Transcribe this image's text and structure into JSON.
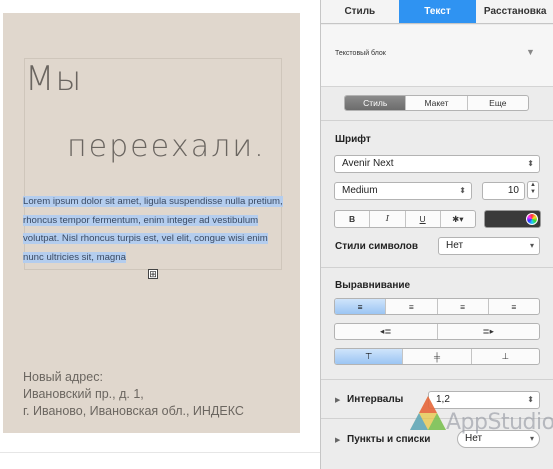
{
  "page": {
    "title_line1": "Мы",
    "title_line2": "переехали.",
    "body_text": "Lorem ipsum dolor sit amet, ligula suspendisse nulla pretium, rhoncus tempor fermentum, enim integer ad vestibulum volutpat. Nisl rhoncus turpis est, vel elit, congue wisi enim nunc ultricies sit, magna",
    "resize_handle": "⊞",
    "address": [
      "Новый адрес:",
      "Ивановский пр., д. 1,",
      "г. Иваново, Ивановская обл., ИНДЕКС"
    ]
  },
  "panel": {
    "tabs": [
      "Стиль",
      "Текст",
      "Расстановка"
    ],
    "active_tab": "Текст",
    "paragraph_style": "Текстовый блок",
    "subtabs": [
      "Стиль",
      "Макет",
      "Еще"
    ],
    "font_section": "Шрифт",
    "font_family": "Avenir Next",
    "font_weight": "Medium",
    "font_size": "10",
    "bold": "B",
    "italic": "I",
    "underline": "U",
    "gear": "✱▾",
    "char_styles_label": "Стили символов",
    "char_styles_value": "Нет",
    "alignment_label": "Выравнивание",
    "align_left": "≡",
    "align_center": "≡",
    "align_right": "≡",
    "align_justify": "≡",
    "indent_decrease": "◂≣",
    "indent_increase": "≣▸",
    "valign_top": "⊤",
    "valign_middle": "╪",
    "valign_bottom": "⊥",
    "spacing_label": "Интервалы",
    "spacing_value": "1,2",
    "bullets_label": "Пункты и списки",
    "bullets_value": "Нет",
    "accent_color": "#2f93f2"
  },
  "watermark": {
    "text": "AppStudio"
  }
}
